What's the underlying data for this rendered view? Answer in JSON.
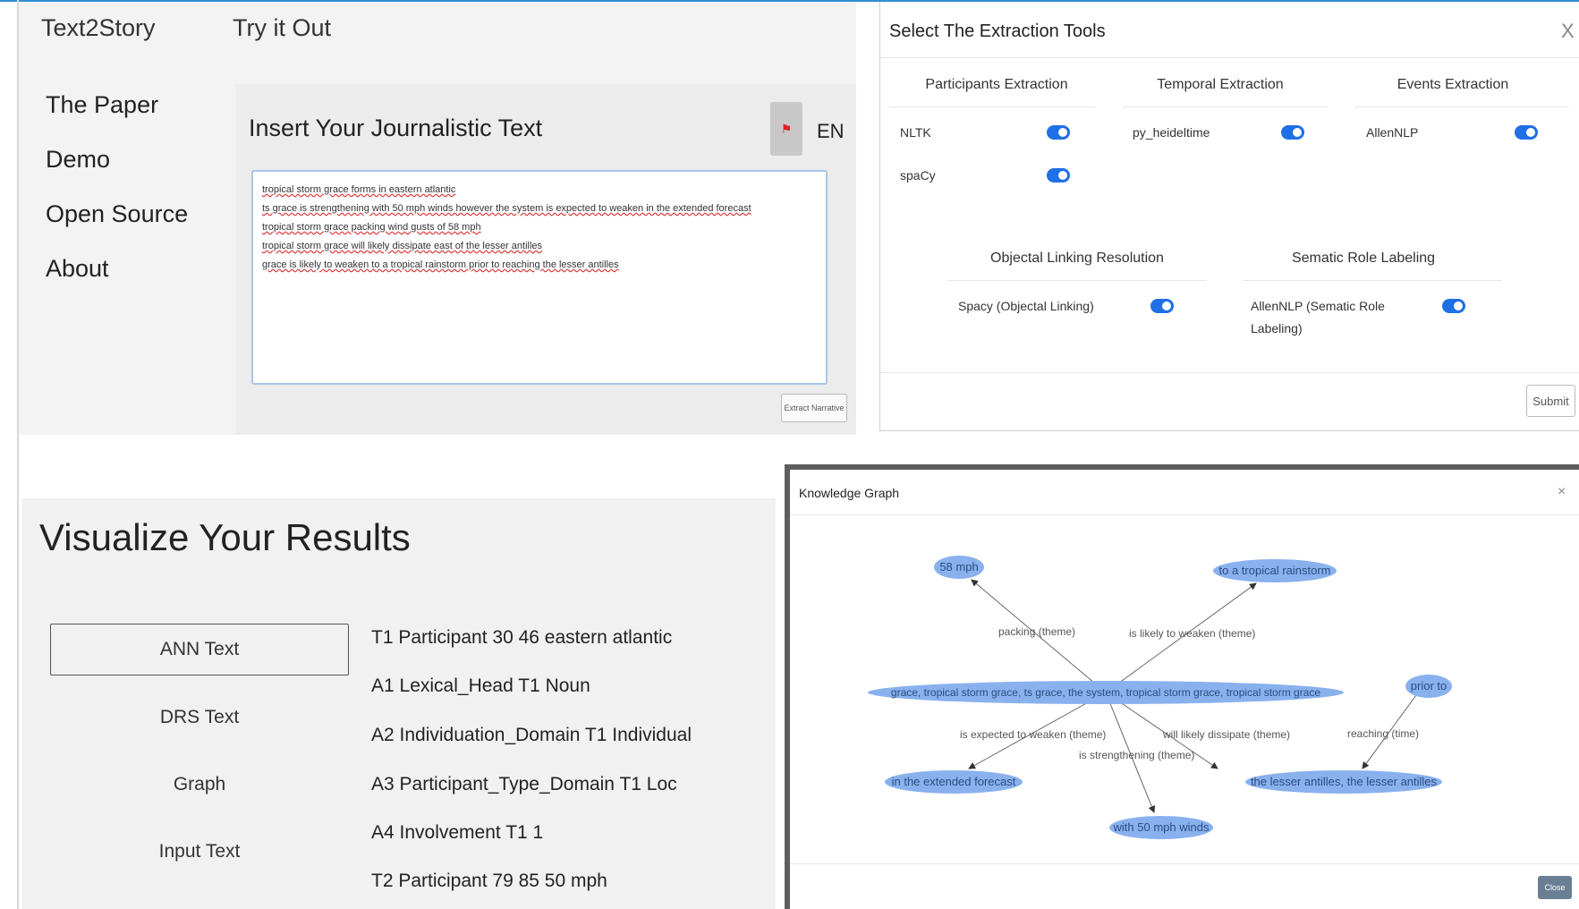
{
  "app": {
    "brand": "Text2Story",
    "top_nav": "Try it Out",
    "nav": [
      "The Paper",
      "Demo",
      "Open Source",
      "About"
    ]
  },
  "editor": {
    "title": "Insert Your Journalistic Text",
    "lang_icon": "flag-icon",
    "lang_label": "EN",
    "lines": [
      "tropical storm grace forms in eastern atlantic",
      "ts grace is strengthening with 50 mph winds however the system is expected to weaken in the extended forecast",
      "tropical storm grace packing wind gusts of 58 mph",
      "tropical storm grace will likely dissipate east of the lesser antilles",
      "grace is likely to weaken to a tropical rainstorm prior to reaching the lesser antilles"
    ],
    "extract_label": "Extract Narrative"
  },
  "extraction_modal": {
    "title": "Select The Extraction Tools",
    "close": "X",
    "participants": {
      "heading": "Participants Extraction",
      "options": [
        "NLTK",
        "spaCy"
      ]
    },
    "temporal": {
      "heading": "Temporal Extraction",
      "options": [
        "py_heideltime"
      ]
    },
    "events": {
      "heading": "Events Extraction",
      "options": [
        "AllenNLP"
      ]
    },
    "objectal": {
      "heading": "Objectal Linking Resolution",
      "options": [
        "Spacy (Objectal Linking)"
      ]
    },
    "semantic": {
      "heading": "Sematic Role Labeling",
      "options_line1": "AllenNLP (Sematic Role",
      "options_line2": "Labeling)"
    },
    "submit_label": "Submit"
  },
  "results": {
    "heading": "Visualize Your Results",
    "tabs": [
      "ANN Text",
      "DRS Text",
      "Graph",
      "Input Text"
    ],
    "active_tab": "ANN Text",
    "ann_lines": [
      "T1 Participant 30 46 eastern atlantic",
      "A1 Lexical_Head T1 Noun",
      "A2 Individuation_Domain T1 Individual",
      "A3 Participant_Type_Domain T1 Loc",
      "A4 Involvement T1 1",
      "T2 Participant 79 85 50 mph"
    ]
  },
  "graph_modal": {
    "title": "Knowledge Graph",
    "close": "×",
    "close_button": "Close",
    "node_color": "#89b1ee",
    "nodes": {
      "n58": "58 mph",
      "rain": "to a tropical rainstorm",
      "center": "grace, tropical storm grace, ts grace, the system, tropical storm grace, tropical storm grace",
      "prior": "prior to",
      "forecast": "in the extended forecast",
      "antilles": "the lesser antilles, the lesser antilles",
      "winds": "with 50 mph winds"
    },
    "edges": {
      "packing": "packing (theme)",
      "weaken_likely": "is likely to weaken (theme)",
      "expected": "is expected to weaken (theme)",
      "dissipate": "will likely dissipate (theme)",
      "strengthening": "is strengthening (theme)",
      "reaching": "reaching (time)"
    }
  }
}
